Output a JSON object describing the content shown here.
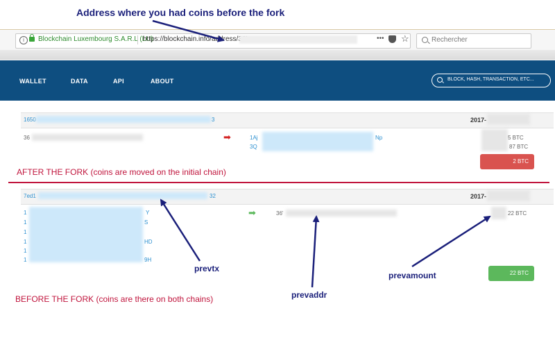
{
  "annotations": {
    "top_note": "Address where you had coins before the fork",
    "after_fork": "AFTER THE FORK (coins are moved on the initial chain)",
    "before_fork": "BEFORE THE FORK (coins are there on both chains)",
    "prevtx": "prevtx",
    "prevaddr": "prevaddr",
    "prevamount": "prevamount"
  },
  "browser": {
    "site_identity": "Blockchain Luxembourg S.A.R.L (LU)",
    "url": "https://blockchain.info/address/36'",
    "page_actions": "•••",
    "search_placeholder": "Rechercher"
  },
  "nav": {
    "items": [
      "WALLET",
      "DATA",
      "API",
      "ABOUT"
    ],
    "search_placeholder": "BLOCK, HASH, TRANSACTION, ETC..."
  },
  "tx_after": {
    "hash_start": "1650",
    "hash_end": "3",
    "date": "2017-",
    "input_addr": "36",
    "outputs": [
      {
        "start": "1Aj",
        "end": "Np",
        "amount": "5 BTC"
      },
      {
        "start": "3Q",
        "end": "",
        "amount": "87 BTC"
      }
    ],
    "total": "2 BTC"
  },
  "tx_before": {
    "hash_start": "7ed1",
    "hash_end": "32",
    "date": "2017-",
    "inputs": [
      {
        "start": "1",
        "end": "Y"
      },
      {
        "start": "1",
        "end": "S"
      },
      {
        "start": "1",
        "end": ""
      },
      {
        "start": "1",
        "end": "HD"
      },
      {
        "start": "1",
        "end": ""
      },
      {
        "start": "1",
        "end": "9H"
      }
    ],
    "output_addr": "36'",
    "output_amount": "22 BTC",
    "total": "22 BTC"
  },
  "colors": {
    "navbar": "#0e4e80",
    "link": "#2a8fd0",
    "red_annotation": "#c0143c",
    "navy_annotation": "#1a1f7a",
    "btn_red": "#d9534f",
    "btn_green": "#5cb85c"
  }
}
